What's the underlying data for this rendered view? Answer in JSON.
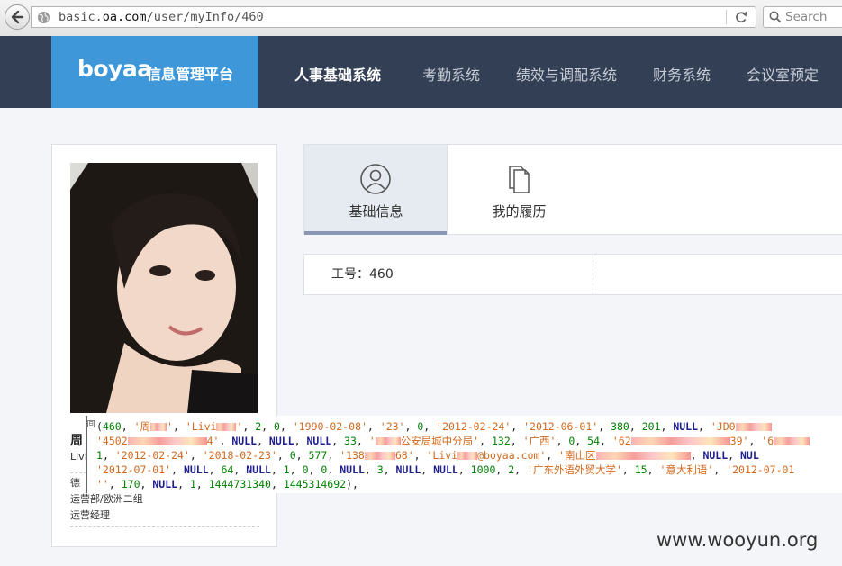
{
  "browser": {
    "url_prefix": "basic.",
    "url_domain": "oa.com",
    "url_path": "/user/myInfo/460",
    "search_placeholder": "Search"
  },
  "nav": {
    "logo_mark": "boyaa",
    "logo_text": "信息管理平台",
    "items": [
      "人事基础系统",
      "考勤系统",
      "绩效与调配系统",
      "财务系统",
      "会议室预定"
    ],
    "active_index": 0
  },
  "tabs": [
    {
      "label": "基础信息",
      "icon": "user-icon",
      "active": true
    },
    {
      "label": "我的履历",
      "icon": "documents-icon",
      "active": false
    }
  ],
  "info": {
    "employee_id": "工号：460"
  },
  "profile": {
    "name": "周",
    "line1": "Livi",
    "line2": "德",
    "department": "运营部/欧洲二组",
    "position": "运营经理"
  },
  "sql_overlay": {
    "fold_marker": "⊟",
    "line1": [
      "(",
      "460",
      ", ",
      "'周",
      "'",
      ", ",
      "'Livi",
      "'",
      ", ",
      "2",
      ", ",
      "0",
      ", ",
      "'1990-02-08'",
      ", ",
      "'23'",
      ", ",
      "0",
      ", ",
      "'2012-02-24'",
      ", ",
      "'2012-06-01'",
      ", ",
      "380",
      ", ",
      "201",
      ", ",
      "NULL",
      ", ",
      "'JD0"
    ],
    "line2": [
      "'4502",
      "4'",
      ", ",
      "NULL",
      ", ",
      "NULL",
      ", ",
      "NULL",
      ", ",
      "33",
      ", ",
      "'",
      "公安局城中分局'",
      ", ",
      "132",
      ", ",
      "'广西'",
      ", ",
      "0",
      ", ",
      "54",
      ", ",
      "'62",
      "39'",
      ", ",
      "'6"
    ],
    "line3": [
      "1",
      ", ",
      "'2012-02-24'",
      ", ",
      "'2018-02-23'",
      ", ",
      "0",
      ", ",
      "577",
      ", ",
      "'138",
      "68'",
      ", ",
      "'Livi",
      "@boyaa.com'",
      ", ",
      "'南山区",
      ", ",
      "NULL",
      ", ",
      "NUL"
    ],
    "line4": [
      "'2012-07-01'",
      ", ",
      "NULL",
      ", ",
      "64",
      ", ",
      "NULL",
      ", ",
      "1",
      ", ",
      "0",
      ", ",
      "0",
      ", ",
      "NULL",
      ", ",
      "3",
      ", ",
      "NULL",
      ", ",
      "NULL",
      ", ",
      "1000",
      ", ",
      "2",
      ", ",
      "'广东外语外贸大学'",
      ", ",
      "15",
      ", ",
      "'意大利语'",
      ", ",
      "'2012-07-01"
    ],
    "line5": [
      "''",
      ", ",
      "170",
      ", ",
      "NULL",
      ", ",
      "1",
      ", ",
      "1444731340",
      ", ",
      "1445314692",
      "),"
    ]
  },
  "watermark": "www.wooyun.org"
}
